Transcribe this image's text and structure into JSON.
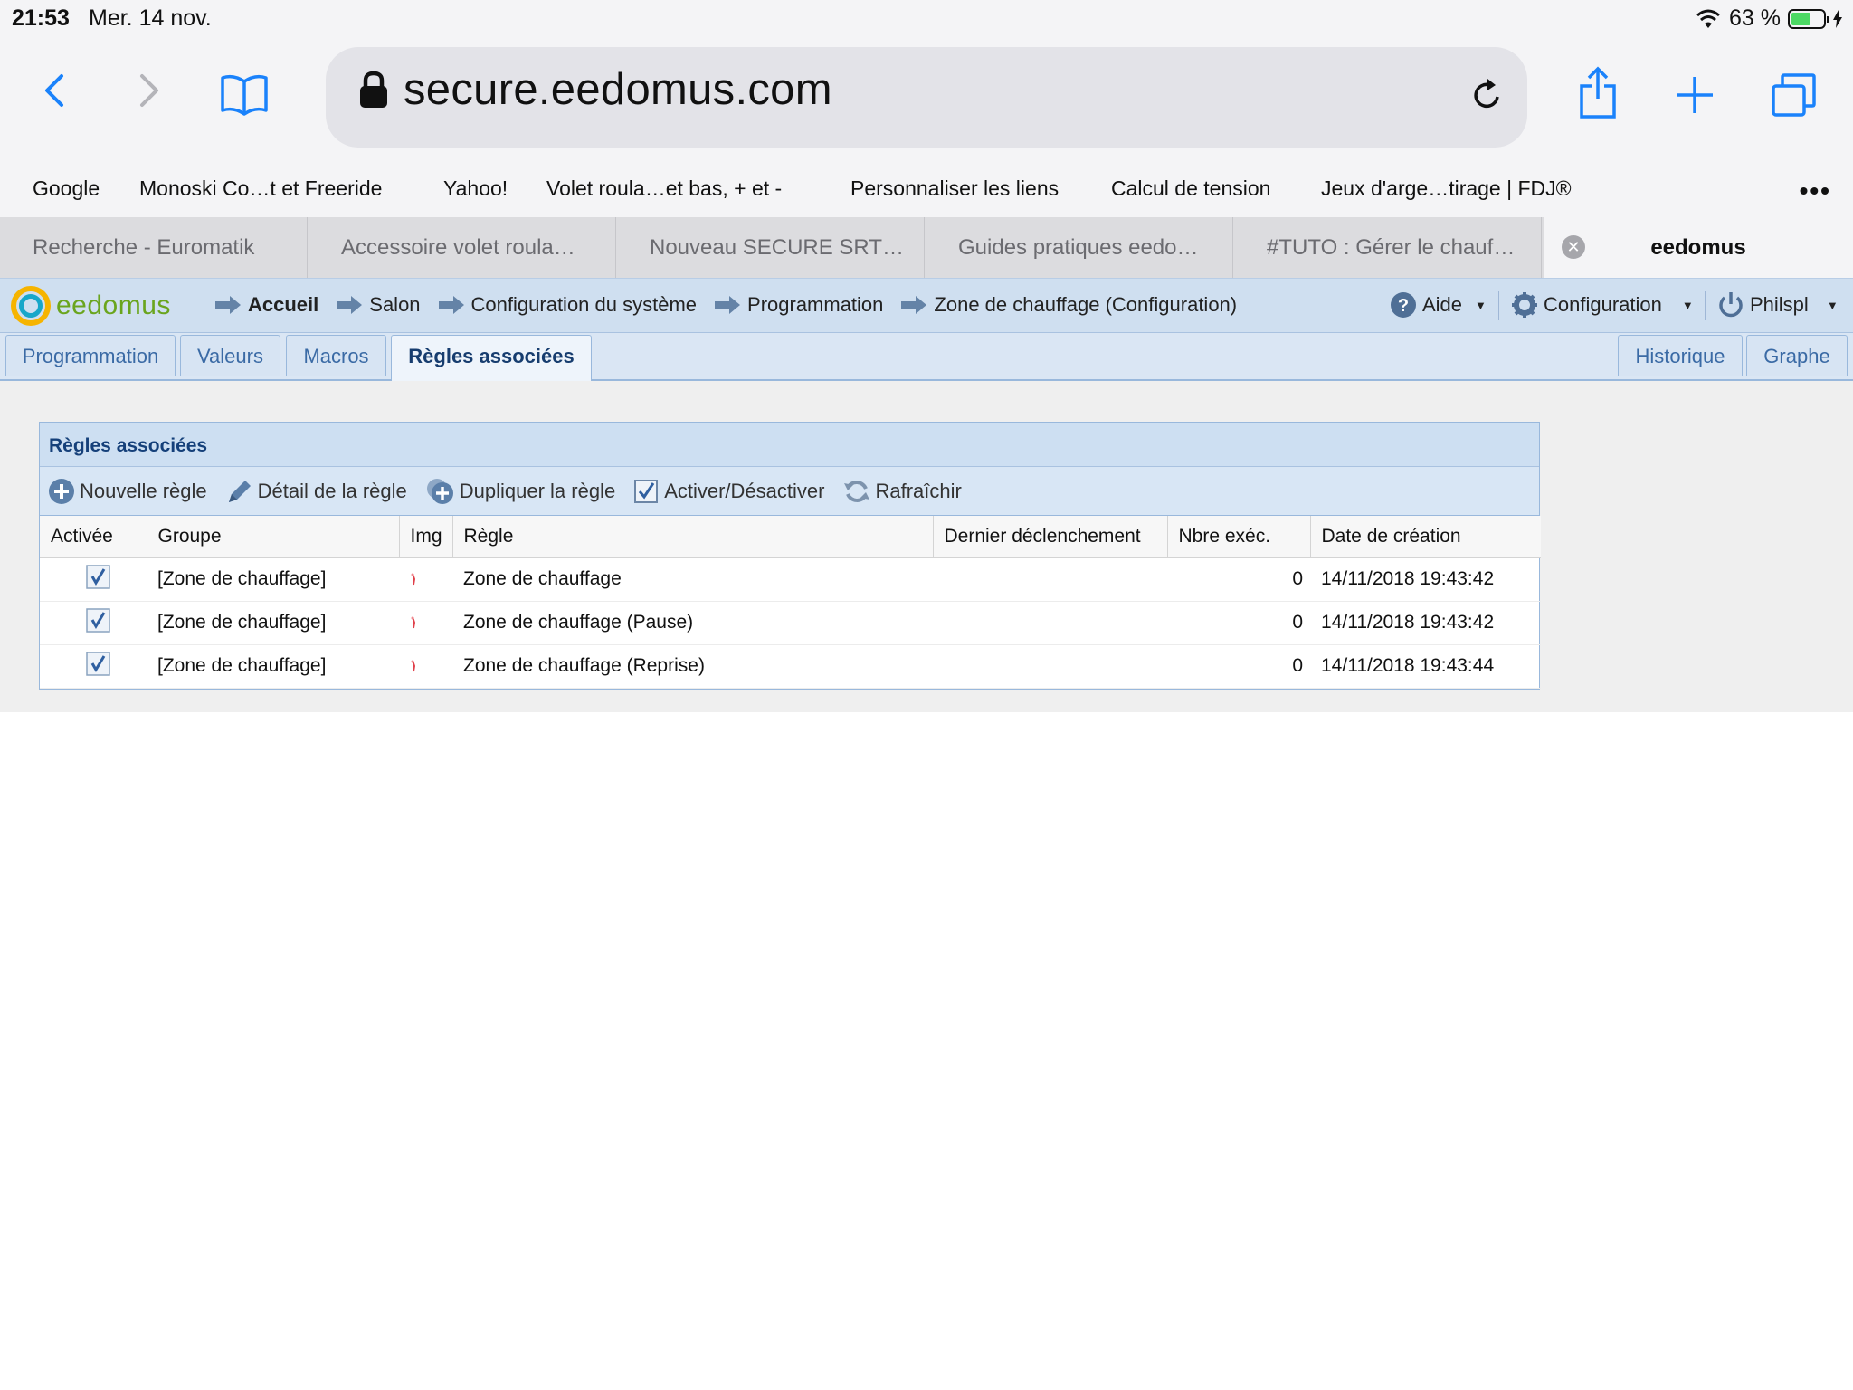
{
  "status_bar": {
    "time": "21:53",
    "date": "Mer. 14 nov.",
    "battery_percent": "63 %",
    "battery_level": 0.63,
    "icons": [
      "wifi-icon",
      "battery-icon",
      "charging-icon"
    ]
  },
  "browser": {
    "url": "secure.eedomus.com",
    "toolbar_icons": [
      "back-icon",
      "forward-icon",
      "bookmarks-icon",
      "lock-icon",
      "reload-icon",
      "share-icon",
      "new-tab-icon",
      "tabs-icon"
    ],
    "accent_color": "#1a82fb",
    "bookmarks": [
      "Google",
      "Monoski Co…t et Freeride",
      "Yahoo!",
      "Volet roula…et bas, + et -",
      "Personnaliser les liens",
      "Calcul de tension",
      "Jeux d'arge…tirage | FDJ®"
    ],
    "more_label": "•••",
    "tabs": [
      "Recherche - Euromatik",
      "Accessoire volet roula…",
      "Nouveau SECURE SRT…",
      "Guides pratiques eedo…",
      "#TUTO : Gérer le chauf…",
      "eedomus"
    ],
    "tab_close_label": "✕"
  },
  "app": {
    "logo_text": "eedomus",
    "breadcrumb": [
      "Accueil",
      "Salon",
      "Configuration du système",
      "Programmation",
      "Zone de chauffage (Configuration)"
    ],
    "help_label": "Aide",
    "config_label": "Configuration",
    "user_label": "Philspl",
    "page_tabs": [
      "Programmation",
      "Valeurs",
      "Macros",
      "Règles associées"
    ],
    "right_tabs": [
      "Historique",
      "Graphe"
    ],
    "active_tab": "Règles associées"
  },
  "panel": {
    "title": "Règles associées",
    "tools": {
      "new_rule": "Nouvelle règle",
      "rule_detail": "Détail de la règle",
      "duplicate": "Dupliquer la règle",
      "toggle": "Activer/Désactiver",
      "refresh": "Rafraîchir"
    },
    "columns": [
      "Activée",
      "Groupe",
      "Img",
      "Règle",
      "Dernier déclenchement",
      "Nbre exéc.",
      "Date de création"
    ],
    "rows": [
      {
        "active": true,
        "group": "[Zone de chauffage]",
        "rule": "Zone de chauffage",
        "last_trigger": "",
        "exec_count": "0",
        "created": "14/11/2018 19:43:42"
      },
      {
        "active": true,
        "group": "[Zone de chauffage]",
        "rule": "Zone de chauffage (Pause)",
        "last_trigger": "",
        "exec_count": "0",
        "created": "14/11/2018 19:43:42"
      },
      {
        "active": true,
        "group": "[Zone de chauffage]",
        "rule": "Zone de chauffage (Reprise)",
        "last_trigger": "",
        "exec_count": "0",
        "created": "14/11/2018 19:43:44"
      }
    ]
  }
}
